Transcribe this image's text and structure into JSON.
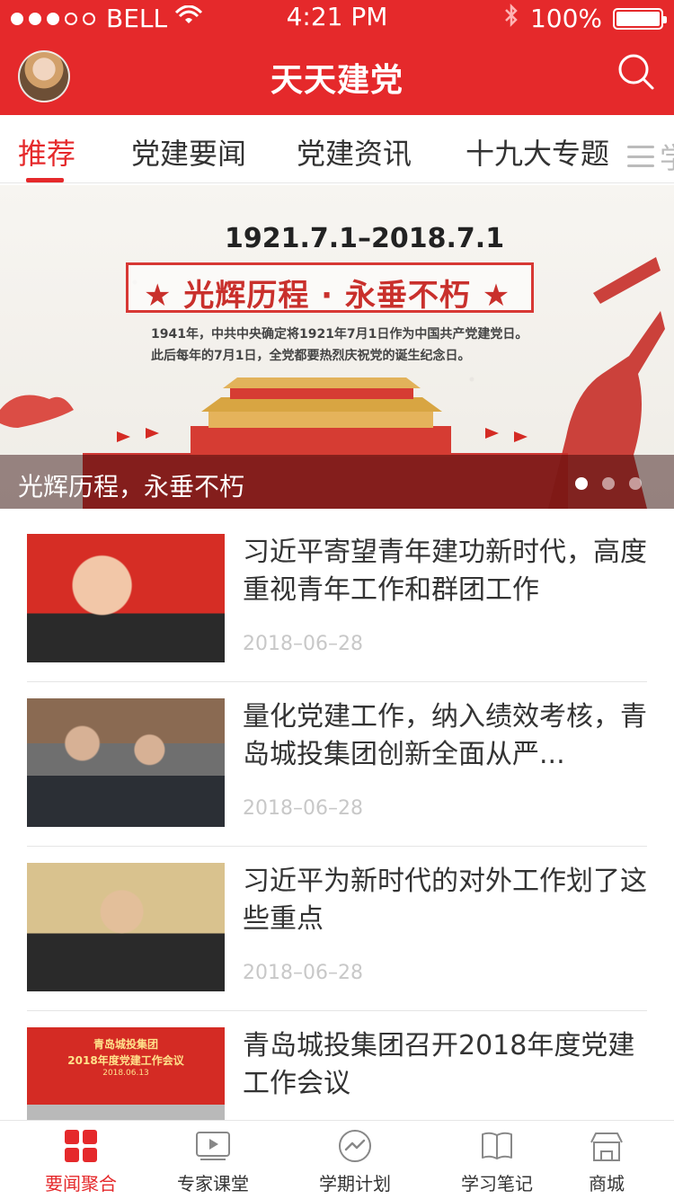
{
  "status_bar": {
    "carrier": "BELL",
    "time": "4:21 PM",
    "battery": "100%"
  },
  "header": {
    "title": "天天建党"
  },
  "tabs": [
    {
      "label": "推荐"
    },
    {
      "label": "党建要闻"
    },
    {
      "label": "党建资讯"
    },
    {
      "label": "十九大专题"
    },
    {
      "label": "学"
    }
  ],
  "banner": {
    "date_range": "1921.7.1–2018.7.1",
    "slogan": "★ 光辉历程 · 永垂不朽 ★",
    "paragraph": "1941年，中共中央确定将1921年7月1日作为中国共产党建党日。此后每年的7月1日，全党都要热烈庆祝党的诞生纪念日。",
    "caption": "光辉历程，永垂不朽",
    "pager_active": 0,
    "pager_count": 3
  },
  "feed": [
    {
      "headline": "习近平寄望青年建功新时代，高度重视青年工作和群团工作",
      "date": "2018–06–28",
      "thumb_style": "red"
    },
    {
      "headline": "量化党建工作，纳入绩效考核，青岛城投集团创新全面从严...",
      "date": "2018–06–28",
      "thumb_style": "meeting"
    },
    {
      "headline": "习近平为新时代的对外工作划了这些重点",
      "date": "2018–06–28",
      "thumb_style": "beige"
    },
    {
      "headline": "青岛城投集团召开2018年度党建工作会议",
      "date": "",
      "thumb_style": "conference",
      "thumb_text": {
        "line1": "青岛城投集团",
        "line2": "2018年度党建工作会议",
        "line3": "2018.06.13"
      }
    }
  ],
  "bottom_tabs": [
    {
      "label": "要闻聚合",
      "icon": "grid-icon",
      "active": true
    },
    {
      "label": "专家课堂",
      "icon": "video-icon",
      "active": false
    },
    {
      "label": "学期计划",
      "icon": "trend-icon",
      "active": false
    },
    {
      "label": "学习笔记",
      "icon": "book-icon",
      "active": false
    },
    {
      "label": "商城",
      "icon": "store-icon",
      "active": false
    }
  ],
  "colors": {
    "primary": "#e5292b",
    "text": "#333333",
    "muted": "#c8c8c8"
  }
}
